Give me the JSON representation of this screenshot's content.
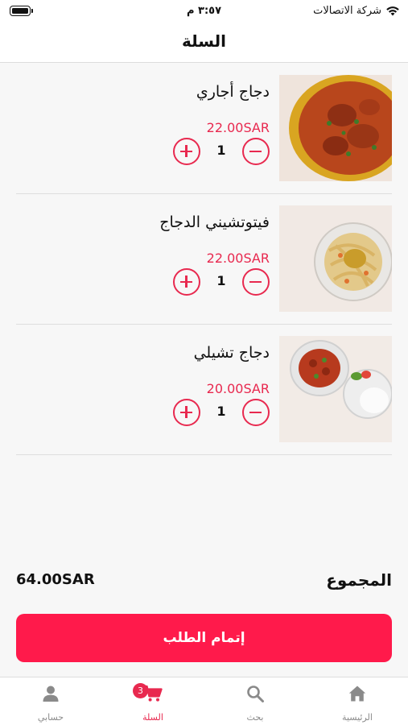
{
  "status_bar": {
    "carrier": "شركة الاتصالات",
    "time": "٣:٥٧ م"
  },
  "header": {
    "title": "السلة"
  },
  "cart": {
    "items": [
      {
        "name": "دجاج أجاري",
        "price": "22.00SAR",
        "quantity": "1",
        "image": "chicken-curry-photo"
      },
      {
        "name": "فيتوتشيني الدجاج",
        "price": "22.00SAR",
        "quantity": "1",
        "image": "chicken-fettuccine-photo"
      },
      {
        "name": "دجاج تشيلي",
        "price": "20.00SAR",
        "quantity": "1",
        "image": "chili-chicken-with-rice-photo"
      }
    ]
  },
  "summary": {
    "total_label": "المجموع",
    "total_value": "64.00SAR"
  },
  "checkout": {
    "label": "إتمام الطلب"
  },
  "tab_bar": {
    "tabs": [
      {
        "label": "الرئيسية",
        "icon": "home-icon"
      },
      {
        "label": "بحث",
        "icon": "search-icon"
      },
      {
        "label": "السلة",
        "icon": "cart-icon",
        "badge": "3",
        "active": true
      },
      {
        "label": "حسابي",
        "icon": "person-icon"
      }
    ]
  },
  "colors": {
    "accent": "#e8294f",
    "checkout_button": "#ff1a4b",
    "inactive_tab": "#8a8a8a"
  }
}
